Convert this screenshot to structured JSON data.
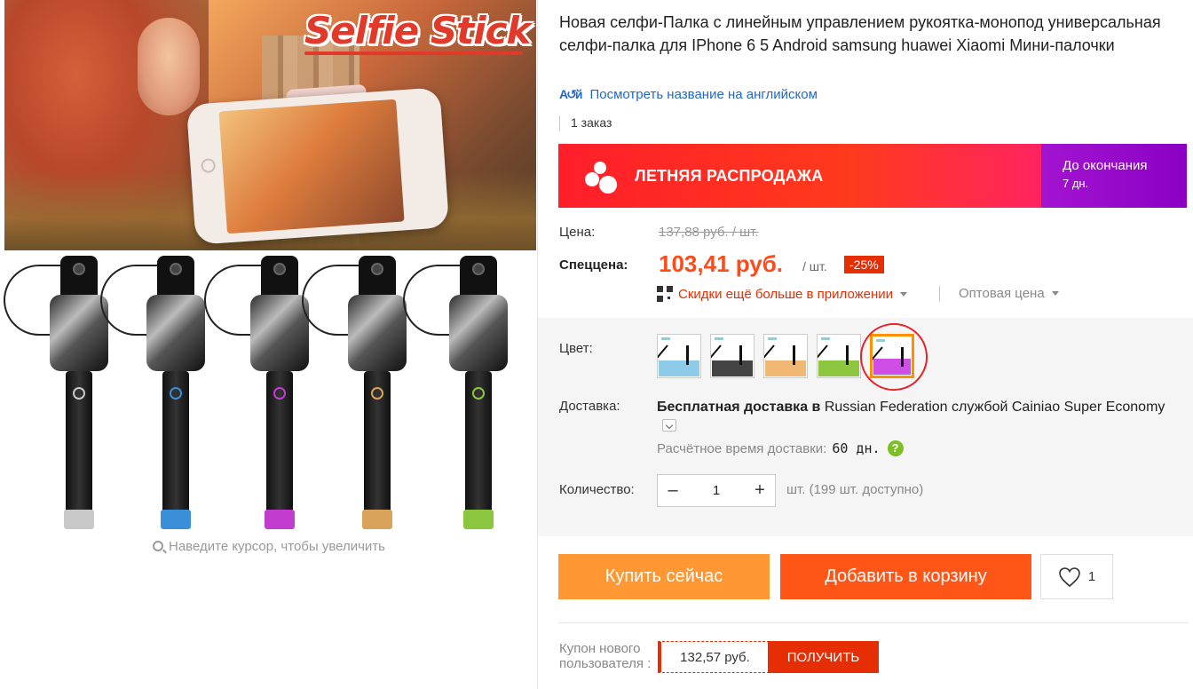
{
  "gallery": {
    "hero_title": "Selfie Stick",
    "zoom_hint": "Наведите курсор, чтобы увеличить",
    "stick_accents": [
      "#c8c8c8",
      "#3a8fd8",
      "#c13ccf",
      "#d9a25a",
      "#8cc63f"
    ]
  },
  "product": {
    "title": "Новая селфи-Палка с линейным управлением рукоятка-монопод универсальная селфи-палка для IPhone 6 5 Android samsung huawei Xiaomi Мини-палочки",
    "translate_link": "Посмотреть название на английском",
    "translate_icon": "translate-icon",
    "orders": "1 заказ"
  },
  "sale_banner": {
    "title": "ЛЕТНЯЯ РАСПРОДАЖА",
    "countdown_label": "До окончания",
    "countdown_value": "7 дн."
  },
  "price": {
    "price_label": "Цена:",
    "old_price": "137,88 руб. / шт.",
    "special_label": "Спеццена:",
    "new_price": "103,41 руб.",
    "unit": "/ шт.",
    "discount": "-25%",
    "app_discount": "Скидки ещё больше в приложении",
    "wholesale": "Оптовая цена"
  },
  "options": {
    "color_label": "Цвет:",
    "swatches": [
      {
        "name": "white",
        "color": "#8ecbe8"
      },
      {
        "name": "black",
        "color": "#444444"
      },
      {
        "name": "gold",
        "color": "#f0b872"
      },
      {
        "name": "green",
        "color": "#8cc63f"
      },
      {
        "name": "purple",
        "color": "#cf4fe6"
      }
    ],
    "selected_swatch": 4,
    "delivery_label": "Доставка:",
    "delivery_bold": "Бесплатная доставка в",
    "delivery_rest": "Russian Federation службой Cainiao Super Economy",
    "eta_label": "Расчётное время доставки:",
    "eta_value": "60 дн.",
    "quantity_label": "Количество:",
    "quantity_value": "1",
    "quantity_note": "шт. (199 шт. доступно)"
  },
  "actions": {
    "buy_now": "Купить сейчас",
    "add_to_cart": "Добавить в корзину",
    "wishlist_count": "1"
  },
  "coupon": {
    "label": "Купон нового пользователя :",
    "value": "132,57 руб.",
    "button": "ПОЛУЧИТЬ"
  },
  "colors": {
    "accent_orange": "#ff9832",
    "cart_orange": "#ff5517",
    "price_red": "#ff4a1a",
    "discount_red": "#e62e04",
    "sale_purple": "#8a00c4",
    "link_blue": "#2268c8"
  }
}
